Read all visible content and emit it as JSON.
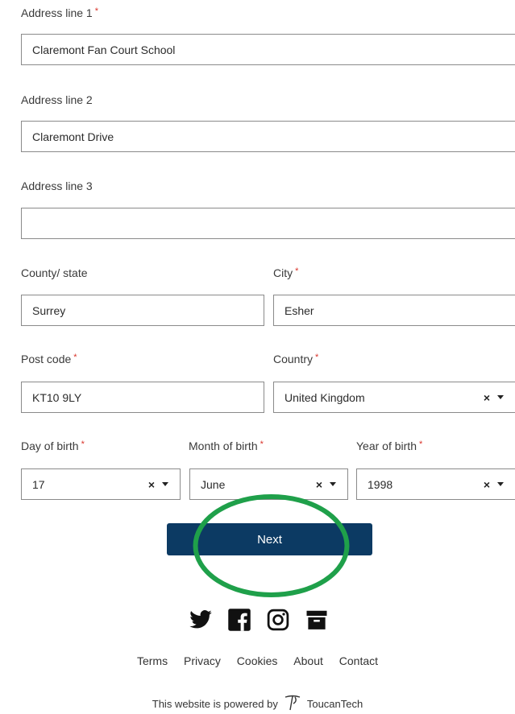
{
  "form": {
    "address1": {
      "label": "Address line 1",
      "required": "*",
      "value": "Claremont Fan Court School"
    },
    "address2": {
      "label": "Address line 2",
      "value": "Claremont Drive"
    },
    "address3": {
      "label": "Address line 3",
      "value": ""
    },
    "county": {
      "label": "County/ state",
      "value": "Surrey"
    },
    "city": {
      "label": "City",
      "required": "*",
      "value": "Esher"
    },
    "postcode": {
      "label": "Post code",
      "required": "*",
      "value": "KT10 9LY"
    },
    "country": {
      "label": "Country",
      "required": "*",
      "value": "United Kingdom"
    },
    "day": {
      "label": "Day of birth",
      "required": "*",
      "value": "17"
    },
    "month": {
      "label": "Month of birth",
      "required": "*",
      "value": "June"
    },
    "year": {
      "label": "Year of birth",
      "required": "*",
      "value": "1998"
    },
    "clear_glyph": "×"
  },
  "next_label": "Next",
  "annotation": {
    "color": "#1fa04a"
  },
  "social": [
    "twitter-icon",
    "facebook-icon",
    "instagram-icon",
    "archive-icon"
  ],
  "footer": {
    "links": [
      "Terms",
      "Privacy",
      "Cookies",
      "About",
      "Contact"
    ],
    "powered_text": "This website is powered by",
    "brand": "ToucanTech"
  },
  "colors": {
    "button": "#0c3a63",
    "required": "#d9342b"
  }
}
